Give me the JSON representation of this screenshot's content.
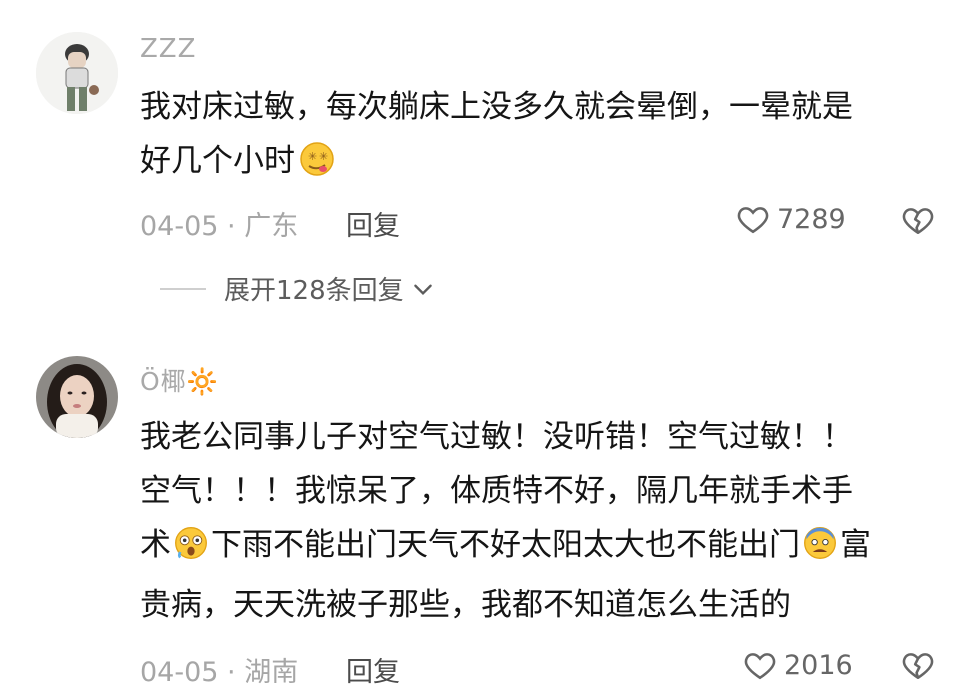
{
  "comments": [
    {
      "username": "ZZZ",
      "lines": [
        "我对床过敏，每次躺床上没多久就会晕倒，一晕就是",
        "好几个小时"
      ],
      "date_loc": "04-05 · 广东",
      "reply_label": "回复",
      "likes": "7289",
      "avatar_icon": "cartoon-boy-avatar",
      "emoji": "dizzy-face-emoji"
    },
    {
      "username": "Ö椰🔆",
      "lines": [
        "我老公同事儿子对空气过敏！没听错！空气过敏！！",
        "空气！！！我惊呆了，体质特不好，隔几年就手术手",
        "术",
        "下雨不能出门天气不好太阳太大也不能出门",
        "富",
        "贵病，天天洗被子那些，我都不知道怎么生活的"
      ],
      "date_loc": "04-05 · 湖南",
      "reply_label": "回复",
      "likes": "2016",
      "avatar_icon": "girl-photo-avatar",
      "emoji": [
        "woozy-face-emoji",
        "anxious-face-emoji"
      ]
    }
  ],
  "expand_replies": "展开128条回复",
  "colors": {
    "text": "#151515",
    "meta": "#a6a6a6",
    "icon": "#666666"
  }
}
